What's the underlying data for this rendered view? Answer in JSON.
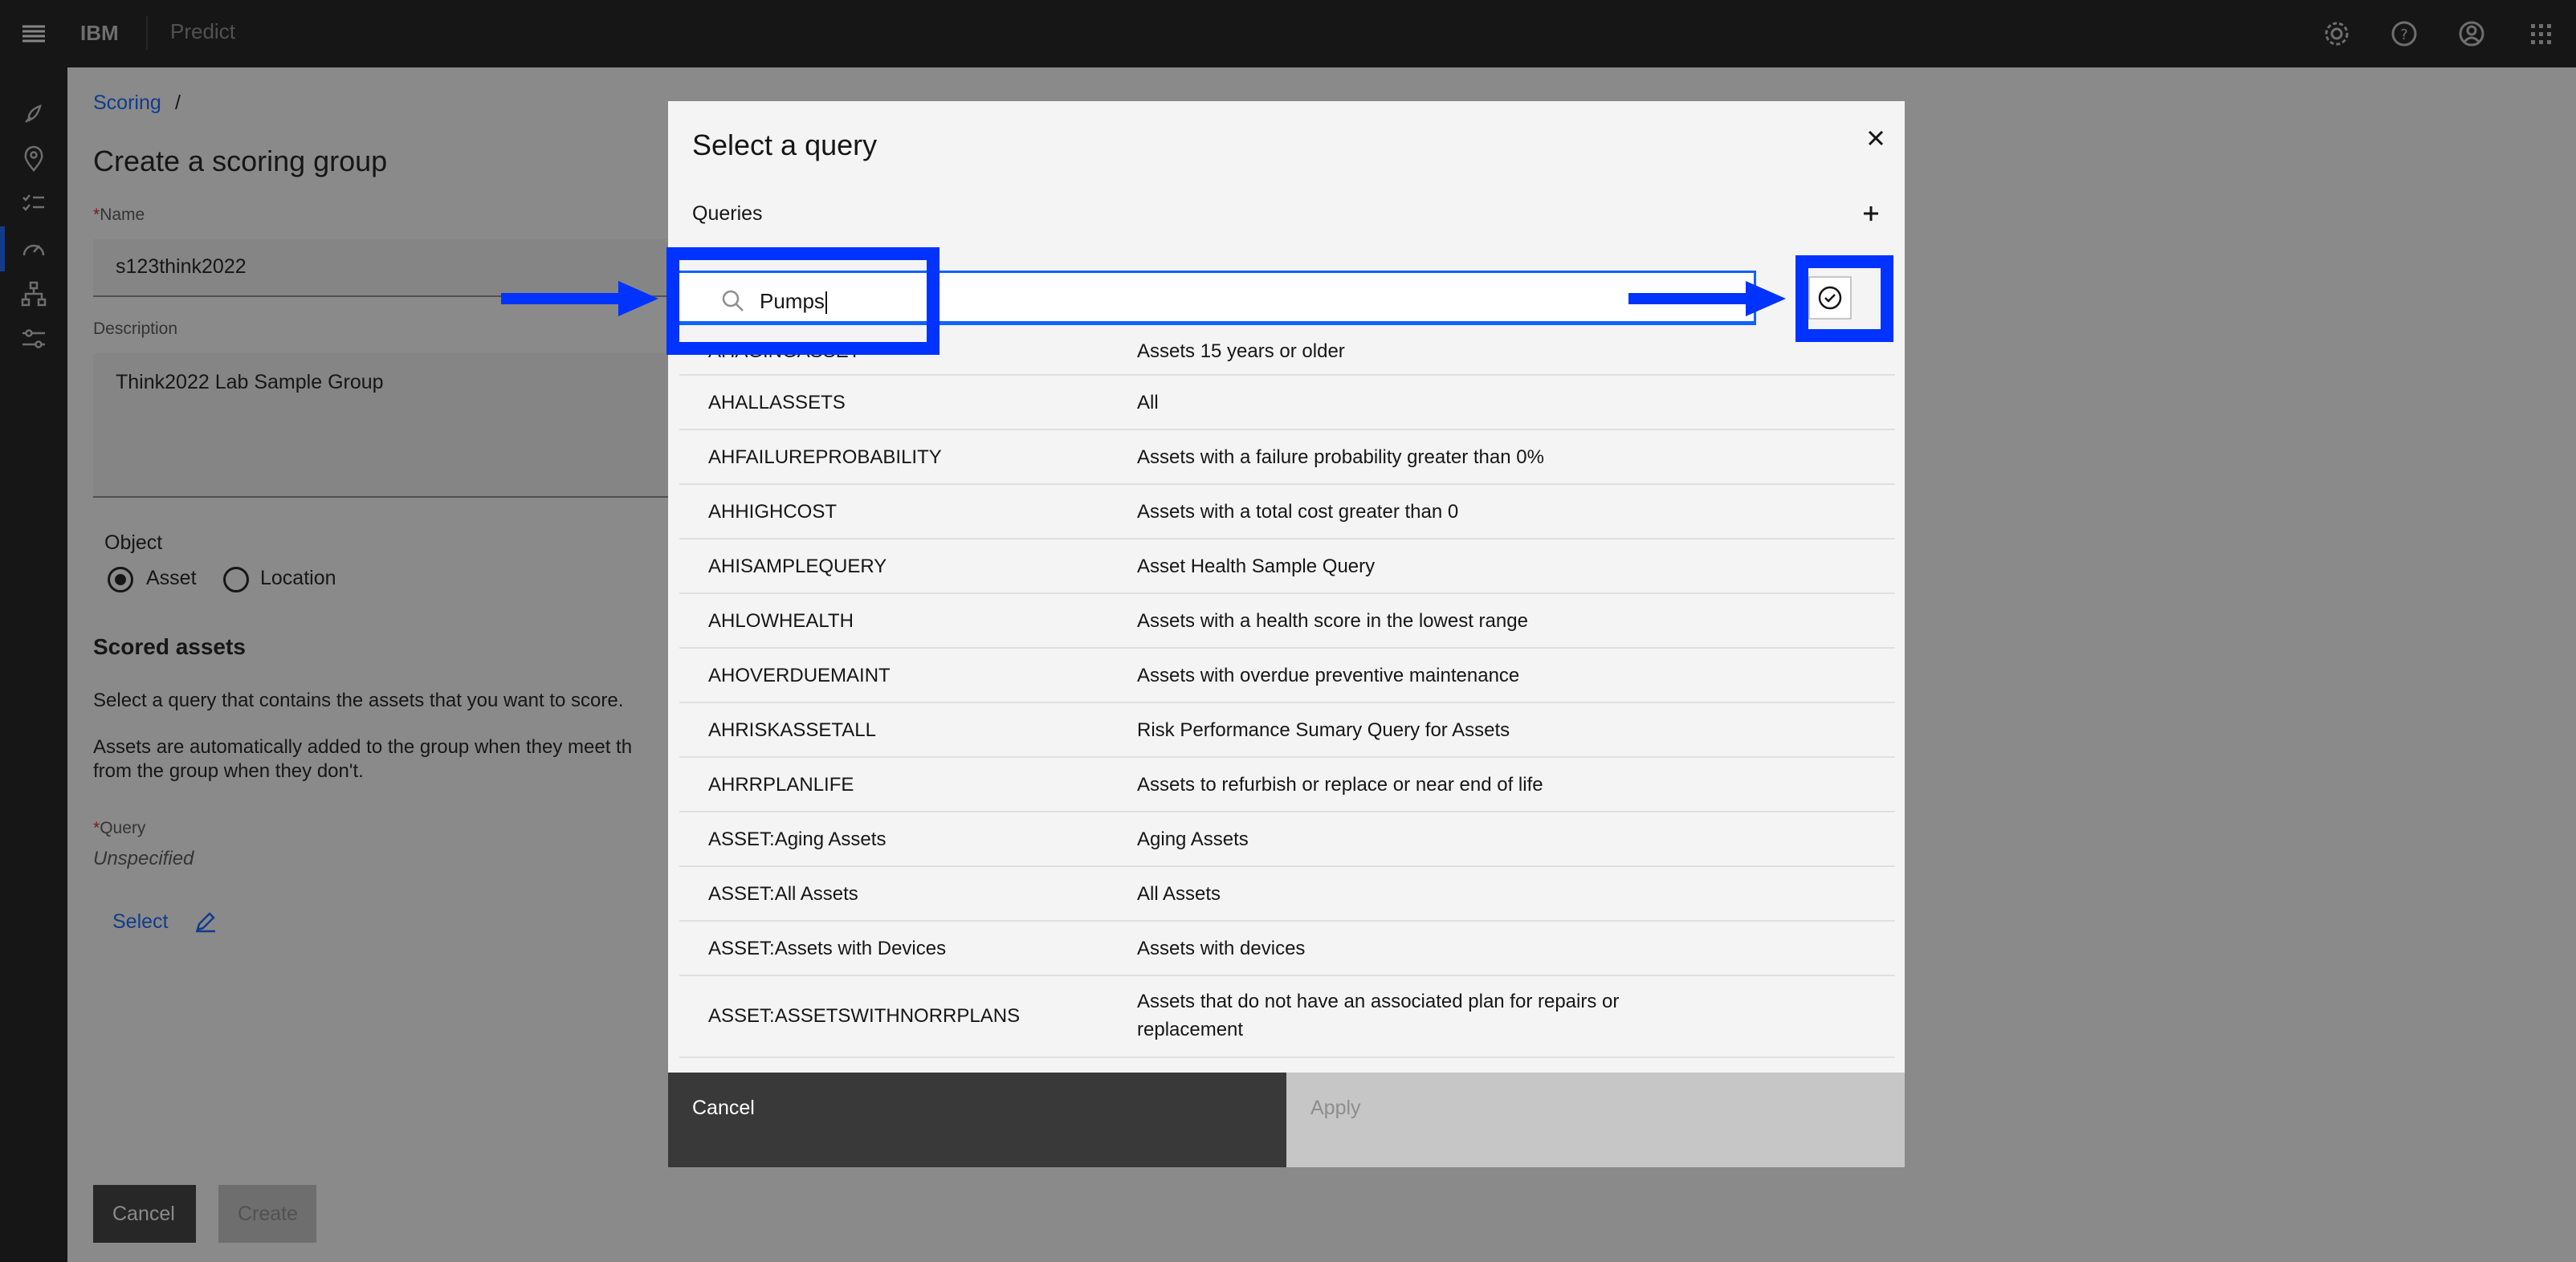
{
  "topbar": {
    "brand": "IBM",
    "app_name": "Predict",
    "icons": [
      "menu-icon",
      "settings-icon",
      "help-icon",
      "user-icon",
      "app-switcher-icon"
    ]
  },
  "rail": {
    "icons": [
      "rocket-icon",
      "location-icon",
      "checklist-icon",
      "gauge-icon",
      "hierarchy-icon",
      "sliders-icon"
    ]
  },
  "page": {
    "breadcrumb": "Scoring",
    "breadcrumb_sep": "/",
    "title": "Create a scoring group",
    "name_label": "Name",
    "name_value": "s123think2022",
    "description_label": "Description",
    "description_value": "Think2022 Lab Sample Group",
    "object_label": "Object",
    "object_options": [
      "Asset",
      "Location"
    ],
    "object_selected": "Asset",
    "scored_assets_heading": "Scored assets",
    "scored_assets_text1": "Select a query that contains the assets that you want to score.",
    "scored_assets_text2": "Assets are automatically added to the group when they meet th\nfrom the group when they don't.",
    "query_label": "Query",
    "query_value": "Unspecified",
    "select_link": "Select",
    "cancel_button": "Cancel",
    "create_button": "Create"
  },
  "modal": {
    "title": "Select a query",
    "section_label": "Queries",
    "search_value": "Pumps",
    "cancel_button": "Cancel",
    "apply_button": "Apply",
    "rows": [
      {
        "name": "AHAGINGASSET",
        "description": "Assets 15 years or older"
      },
      {
        "name": "AHALLASSETS",
        "description": "All"
      },
      {
        "name": "AHFAILUREPROBABILITY",
        "description": "Assets with a failure probability greater than 0%"
      },
      {
        "name": "AHHIGHCOST",
        "description": "Assets with a total cost greater than 0"
      },
      {
        "name": "AHISAMPLEQUERY",
        "description": "Asset Health Sample Query"
      },
      {
        "name": "AHLOWHEALTH",
        "description": "Assets with a health score in the lowest range"
      },
      {
        "name": "AHOVERDUEMAINT",
        "description": "Assets with overdue preventive maintenance"
      },
      {
        "name": "AHRISKASSETALL",
        "description": "Risk Performance Sumary Query for Assets"
      },
      {
        "name": "AHRRPLANLIFE",
        "description": "Assets to refurbish or replace or near end of life"
      },
      {
        "name": "ASSET:Aging Assets",
        "description": "Aging Assets"
      },
      {
        "name": "ASSET:All Assets",
        "description": "All Assets"
      },
      {
        "name": "ASSET:Assets with Devices",
        "description": "Assets with devices"
      },
      {
        "name": "ASSET:ASSETSWITHNORRPLANS",
        "description": "Assets that do not have an associated plan for repairs or replacement"
      }
    ]
  },
  "colors": {
    "accent": "#0f62fe",
    "callout": "#0033ff",
    "topbar_bg": "#161616"
  }
}
